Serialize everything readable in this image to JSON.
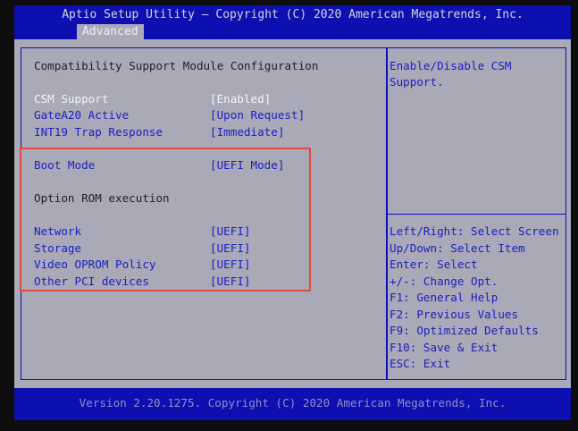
{
  "header": {
    "title": "Aptio Setup Utility – Copyright (C) 2020 American Megatrends, Inc.",
    "active_tab": "Advanced"
  },
  "main": {
    "section_title": "Compatibility Support Module Configuration",
    "settings": [
      {
        "label": "CSM Support",
        "value": "[Enabled]"
      },
      {
        "label": "GateA20 Active",
        "value": "[Upon Request]"
      },
      {
        "label": "INT19 Trap Response",
        "value": "[Immediate]"
      },
      {
        "label": "Boot Mode",
        "value": "[UEFI Mode]"
      }
    ],
    "subsection_title": "Option ROM execution",
    "option_rom": [
      {
        "label": "Network",
        "value": "[UEFI]"
      },
      {
        "label": "Storage",
        "value": "[UEFI]"
      },
      {
        "label": "Video OPROM Policy",
        "value": "[UEFI]"
      },
      {
        "label": "Other PCI devices",
        "value": "[UEFI]"
      }
    ]
  },
  "help": {
    "lines": [
      "Enable/Disable CSM",
      "Support."
    ]
  },
  "keys": [
    "Left/Right: Select Screen",
    "Up/Down: Select Item",
    "Enter: Select",
    "+/-: Change Opt.",
    "F1: General Help",
    "F2: Previous Values",
    "F9: Optimized Defaults",
    "F10: Save & Exit",
    "ESC: Exit"
  ],
  "footer": {
    "text": "Version 2.20.1275. Copyright (C) 2020 American Megatrends, Inc."
  },
  "colors": {
    "bar": "#0d0fb0",
    "panel": "#a9a9b7",
    "selected_text": "#f4f4ff",
    "item_text": "#1a1fc0",
    "highlight": "#e5483e"
  }
}
